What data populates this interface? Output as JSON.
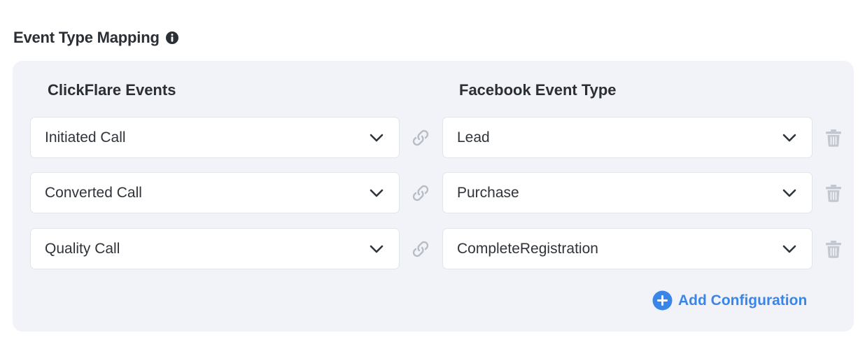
{
  "section": {
    "title": "Event Type Mapping"
  },
  "columns": {
    "left": "ClickFlare Events",
    "right": "Facebook Event Type"
  },
  "rows": [
    {
      "clickflare_event": "Initiated Call",
      "facebook_event": "Lead"
    },
    {
      "clickflare_event": "Converted Call",
      "facebook_event": "Purchase"
    },
    {
      "clickflare_event": "Quality Call",
      "facebook_event": "CompleteRegistration"
    }
  ],
  "actions": {
    "add_label": "Add Configuration"
  },
  "icons": {
    "info": "info-icon",
    "link": "link-icon",
    "chevron": "chevron-down-icon",
    "delete": "trash-icon",
    "add": "plus-circle-icon"
  },
  "colors": {
    "accent": "#3a86e8",
    "panel": "#f2f3f8",
    "muted_icon": "#c3c7cf"
  }
}
